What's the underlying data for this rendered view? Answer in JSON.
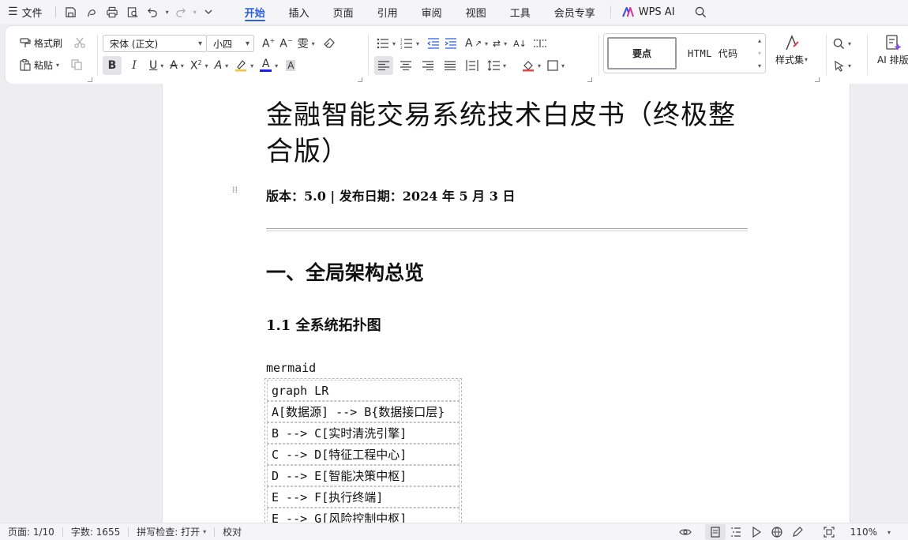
{
  "menubar": {
    "file_label": "文件",
    "tabs": [
      "开始",
      "插入",
      "页面",
      "引用",
      "审阅",
      "视图",
      "工具",
      "会员专享"
    ],
    "active_tab": "开始",
    "wps_ai_label": "WPS AI",
    "accent_color": "#2a5fe0"
  },
  "ribbon": {
    "format_painter_label": "格式刷",
    "paste_label": "粘贴",
    "font_name": "宋体 (正文)",
    "font_size": "小四",
    "styles": {
      "style1": "要点",
      "style2": "HTML 代码"
    },
    "style_set_label": "样式集",
    "ai_layout_label": "AI 排版",
    "font_color": "#1a1aff",
    "highlight_color": "#f0c43c"
  },
  "document": {
    "title": "金融智能交易系统技术白皮书（终极整合版）",
    "meta_line": "版本：5.0 | 发布日期：2024 年 5 月 3 日",
    "heading1": "一、全局架构总览",
    "heading2": "1.1  全系统拓扑图",
    "code_lang": "mermaid",
    "code_lines": [
      "graph LR",
      "A[数据源] --> B{数据接口层}",
      "B --> C[实时清洗引擎]",
      "C --> D[特征工程中心]",
      "D --> E[智能决策中枢]",
      "E --> F[执行终端]",
      "E --> G[风险控制中枢]"
    ]
  },
  "statusbar": {
    "page_label": "页面: 1/10",
    "word_count_label": "字数: 1655",
    "spell_check_label": "拼写检查: 打开",
    "proofread_label": "校对",
    "zoom_label": "110%"
  }
}
